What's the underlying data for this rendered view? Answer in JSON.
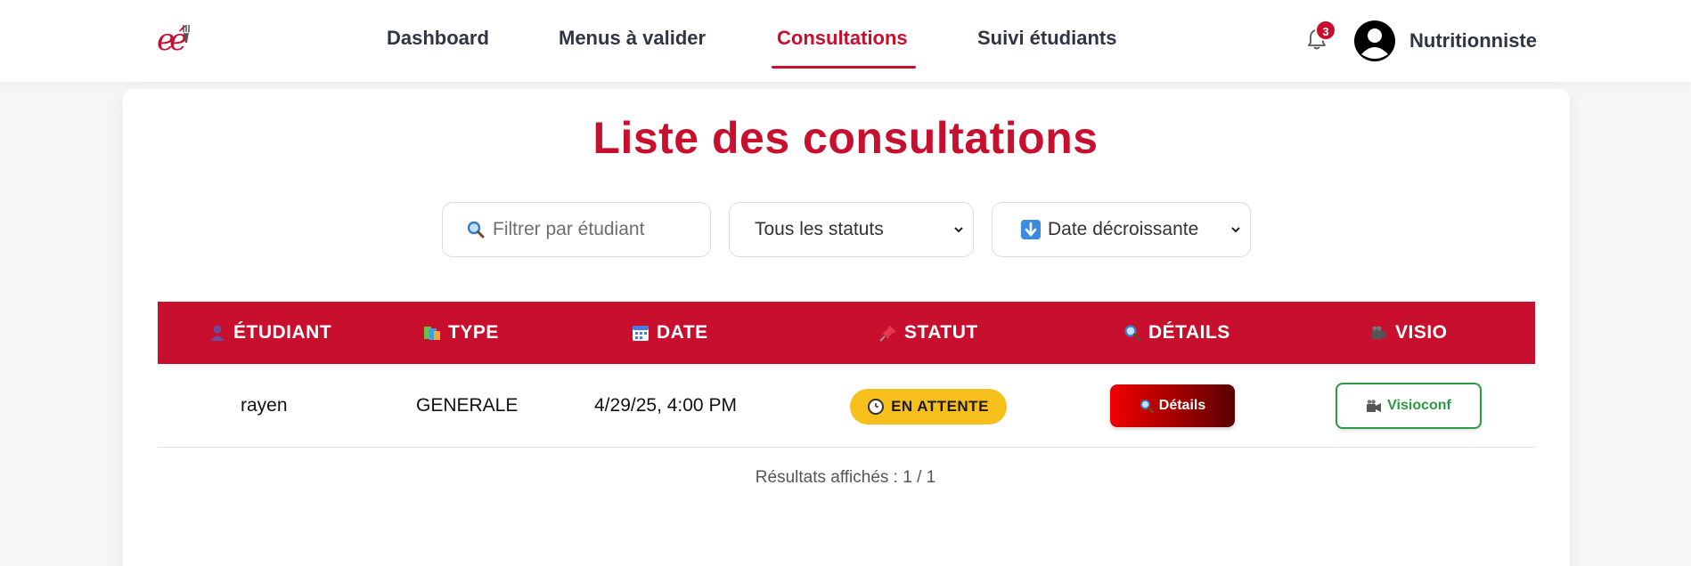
{
  "nav": {
    "links": [
      "Dashboard",
      "Menus à valider",
      "Consultations",
      "Suivi étudiants"
    ],
    "active": "Consultations",
    "notification_count": "3",
    "user_name": "Nutritionniste"
  },
  "page": {
    "title": "Liste des consultations"
  },
  "filters": {
    "search_placeholder": "Filtrer par étudiant",
    "search_value": "",
    "status_selected": "Tous les statuts",
    "sort_selected": "Date décroissante"
  },
  "table": {
    "headers": [
      "ÉTUDIANT",
      "TYPE",
      "DATE",
      "STATUT",
      "DÉTAILS",
      "VISIO"
    ],
    "rows": [
      {
        "etudiant": "rayen",
        "type": "GENERALE",
        "date": "4/29/25, 4:00 PM",
        "statut": "EN ATTENTE",
        "details_label": "Détails",
        "visio_label": "Visioconf"
      }
    ]
  },
  "results_text": "Résultats affichés : 1 / 1",
  "colors": {
    "brand": "#c8102e",
    "status_wait": "#f6bf1b",
    "visio_green": "#2c9a45"
  },
  "icons": {
    "th_etudiant": "person-icon",
    "th_type": "books-icon",
    "th_date": "calendar-icon",
    "th_statut": "pushpin-icon",
    "th_details": "magnifier-icon",
    "th_visio": "video-camera-icon"
  }
}
